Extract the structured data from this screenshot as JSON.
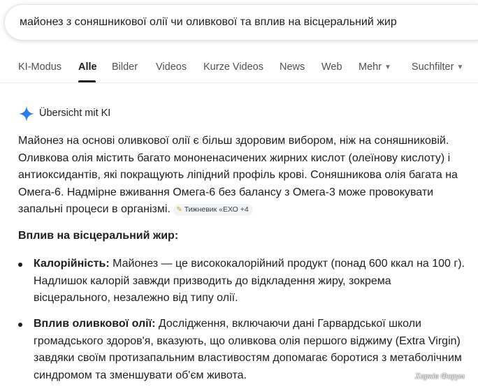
{
  "search": {
    "query": "майонез з соняшникової олії чи оливкової та вплив на вісцеральний жир"
  },
  "tabs": [
    {
      "label": "KI-Modus"
    },
    {
      "label": "Alle"
    },
    {
      "label": "Bilder"
    },
    {
      "label": "Videos"
    },
    {
      "label": "Kurze Videos"
    },
    {
      "label": "News"
    },
    {
      "label": "Web"
    },
    {
      "label": "Mehr"
    },
    {
      "label": "Suchfilter"
    }
  ],
  "active_tab": "Alle",
  "ai_overview": {
    "title": "Übersicht mit KI",
    "icon": "sparkle-icon",
    "accent_color": "#4285f4",
    "paragraph": "Майонез на основі оливкової олії є більш здоровим вибором, ніж на соняшниковій. Оливкова олія містить багато мононенасичених жирних кислот (олеїнову кислоту) і антиоксидантів, які покращують ліпідний профіль крові. Соняшникова олія багата на Омега-6. Надмірне вживання Омега-6 без балансу з Омега-3 може провокувати запальні процеси в організмі.",
    "source_chip": "Тижневик «ЕХО +4",
    "section_heading": "Вплив на вісцеральний жир:",
    "bullets": [
      {
        "title": "Калорійність:",
        "text": "Майонез — це висококалорійний продукт (понад 600 ккал на 100 г). Надлишок калорій завжди призводить до відкладення жиру, зокрема вісцерального, незалежно від типу олії."
      },
      {
        "title": "Вплив оливкової олії:",
        "text": "Дослідження, включаючи дані Гарвардської школи громадського здоров'я, вказують, що оливкова олія першого віджиму (Extra Virgin) завдяки своїм протизапальним властивостям допомагає боротися з метаболічним синдромом та зменшувати об'єм живота."
      }
    ]
  },
  "watermark": "Харків Форум"
}
